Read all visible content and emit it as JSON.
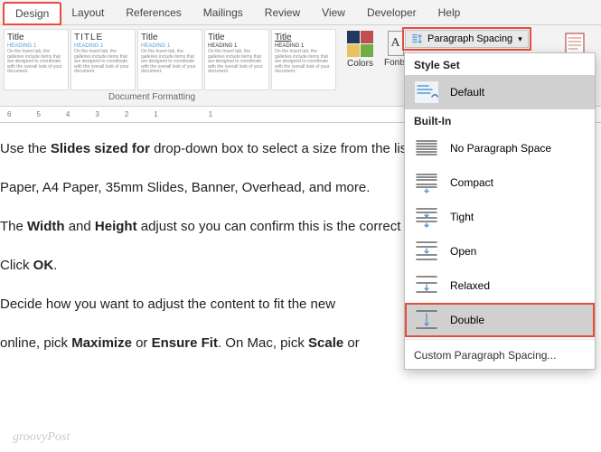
{
  "tabs": {
    "design": "Design",
    "layout": "Layout",
    "references": "References",
    "mailings": "Mailings",
    "review": "Review",
    "view": "View",
    "developer": "Developer",
    "help": "Help"
  },
  "ribbon": {
    "gallery_title": "Title",
    "gallery_heading": "Heading 1",
    "gallery_title_caps": "TITLE",
    "gallery_heading_caps": "HEADING 1",
    "gallery_body": "On the Insert tab, the galleries include items that are designed to coordinate with the overall look of your document.",
    "group_label": "Document Formatting",
    "colors": "Colors",
    "fonts": "Fonts",
    "paragraph_spacing": "Paragraph Spacing",
    "swatches": [
      "#1f3a5f",
      "#c0504d",
      "#e8c360",
      "#70ad47"
    ]
  },
  "ruler": [
    "6",
    "5",
    "4",
    "3",
    "2",
    "1",
    "",
    "1"
  ],
  "document": {
    "p1a": "Use the ",
    "p1b": "Slides sized for",
    "p1c": " drop-down box to select a size from the list. You'll s",
    "p2": "Paper, A4 Paper, 35mm Slides, Banner, Overhead, and more.",
    "p3a": "The ",
    "p3b": "Width",
    "p3c": " and ",
    "p3d": "Height",
    "p3e": " adjust so you can confirm this is the correct size.",
    "p4a": "Click ",
    "p4b": "OK",
    "p4c": ".",
    "p5": "Decide how you want to adjust the content to fit the new",
    "p6a": "online, pick ",
    "p6b": "Maximize",
    "p6c": " or ",
    "p6d": "Ensure Fit",
    "p6e": ". On Mac, pick ",
    "p6f": "Scale",
    "p6g": " or"
  },
  "dropdown": {
    "style_set": "Style Set",
    "default": "Default",
    "built_in": "Built-In",
    "no_space": "No Paragraph Space",
    "compact": "Compact",
    "tight": "Tight",
    "open": "Open",
    "relaxed": "Relaxed",
    "double": "Double",
    "custom": "Custom Paragraph Spacing..."
  },
  "watermark": "groovyPost"
}
